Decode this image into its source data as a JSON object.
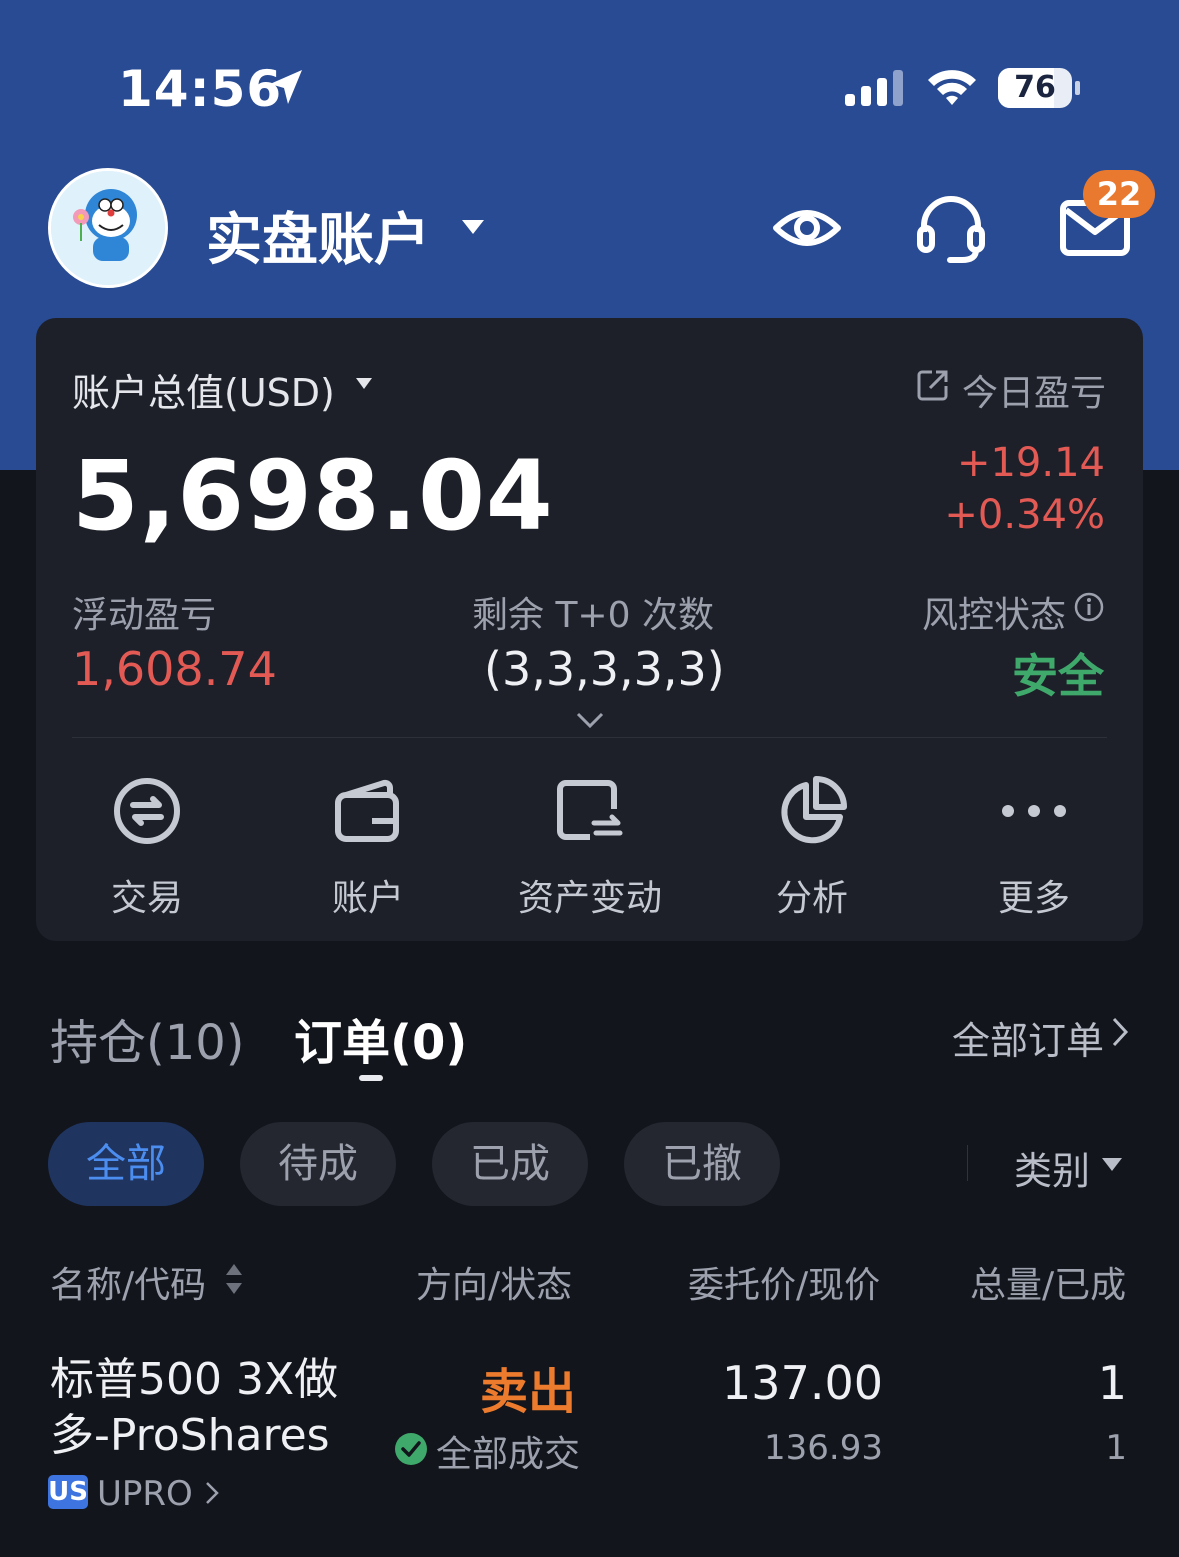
{
  "status_bar": {
    "time": "14:56",
    "battery": "76",
    "battery_level": 0.76
  },
  "header": {
    "account_title": "实盘账户",
    "badge_count": "22"
  },
  "summary": {
    "total_label": "账户总值(USD)",
    "total_value": "5,698.04",
    "today_label": "今日盈亏",
    "today_pnl": "+19.14",
    "today_pct": "+0.34%",
    "float_label": "浮动盈亏",
    "float_value": "1,608.74",
    "t0_label": "剩余 T+0 次数",
    "t0_value": "(3,3,3,3,3)",
    "risk_label": "风控状态",
    "risk_value": "安全"
  },
  "actions": [
    {
      "label": "交易",
      "icon": "trade-icon"
    },
    {
      "label": "账户",
      "icon": "wallet-icon"
    },
    {
      "label": "资产变动",
      "icon": "asset-change-icon"
    },
    {
      "label": "分析",
      "icon": "pie-chart-icon"
    },
    {
      "label": "更多",
      "icon": "more-icon"
    }
  ],
  "tabs": {
    "positions": "持仓(10)",
    "orders": "订单(0)",
    "all_orders": "全部订单"
  },
  "filters": {
    "all": "全部",
    "pending": "待成",
    "filled": "已成",
    "cancelled": "已撤",
    "category": "类别"
  },
  "columns": {
    "name": "名称/代码",
    "side": "方向/状态",
    "price": "委托价/现价",
    "qty": "总量/已成"
  },
  "orders": [
    {
      "name": "标普500 3X做多-ProShares",
      "market": "US",
      "code": "UPRO",
      "side": "卖出",
      "status": "全部成交",
      "order_price": "137.00",
      "current_price": "136.93",
      "total_qty": "1",
      "filled_qty": "1"
    }
  ],
  "colors": {
    "header_blue": "#284b94",
    "up_red": "#e35a55",
    "safe_green": "#3fa86b",
    "sell_orange": "#ec7b2e",
    "active_blue": "#4c8df0",
    "badge_orange": "#e8792f"
  }
}
